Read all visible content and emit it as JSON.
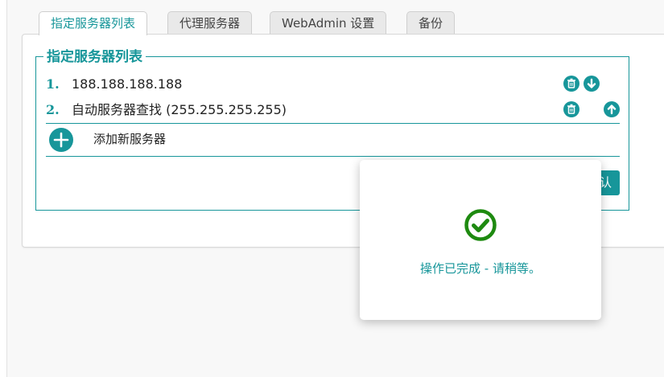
{
  "tabs": [
    {
      "label": "指定服务器列表",
      "active": true
    },
    {
      "label": "代理服务器",
      "active": false
    },
    {
      "label": "WebAdmin 设置",
      "active": false
    },
    {
      "label": "备份",
      "active": false
    }
  ],
  "server_list": {
    "legend": "指定服务器列表",
    "items": [
      {
        "number": "1.",
        "label": "188.188.188.188"
      },
      {
        "number": "2.",
        "label": "自动服务器查找 (255.255.255.255)"
      }
    ],
    "add_label": "添加新服务器",
    "confirm_label": "认"
  },
  "dialog": {
    "message": "操作已完成 - 请稍等。"
  },
  "icons": {
    "delete": "trash-icon",
    "move_down": "arrow-down-icon",
    "move_up": "arrow-up-icon",
    "add": "plus-icon",
    "success": "check-circle-icon"
  },
  "colors": {
    "accent": "#17969a",
    "success": "#1e8a10"
  }
}
